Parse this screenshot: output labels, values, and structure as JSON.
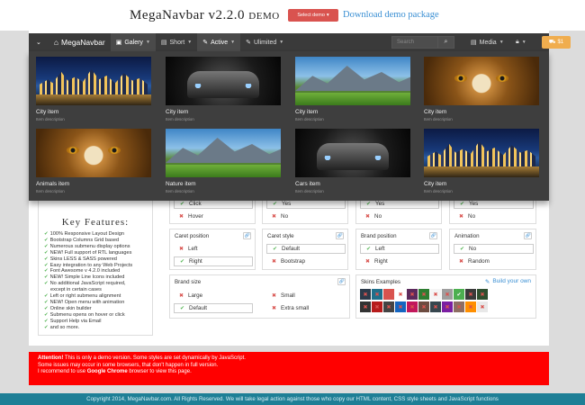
{
  "header": {
    "title_main": "MegaNavbar v2.2.0",
    "title_suffix": "demo",
    "select_demo": "Select demo",
    "download": "Download demo package"
  },
  "navbar": {
    "brand": "MegaNavbar",
    "items": [
      {
        "label": "Galery"
      },
      {
        "label": "Short"
      },
      {
        "label": "Active"
      },
      {
        "label": "Ulimited"
      }
    ],
    "search_placeholder": "Search",
    "media": "Media",
    "cart_count": "$1"
  },
  "dropdown": {
    "tiles": [
      {
        "title": "City item",
        "desc": "Item description",
        "art": "city"
      },
      {
        "title": "City item",
        "desc": "Item description",
        "art": "car"
      },
      {
        "title": "City item",
        "desc": "Item description",
        "art": "mount"
      },
      {
        "title": "City item",
        "desc": "Item description",
        "art": "eagle"
      },
      {
        "title": "Animals item",
        "desc": "Item description",
        "art": "eagle"
      },
      {
        "title": "Nature item",
        "desc": "Item description",
        "art": "mount"
      },
      {
        "title": "Cars item",
        "desc": "Item description",
        "art": "car"
      },
      {
        "title": "City item",
        "desc": "Item description",
        "art": "city"
      }
    ]
  },
  "features": {
    "heading": "Key Features:",
    "items": [
      "100% Responsive Layout Design",
      "Bootstrap Columns Grid based",
      "Numerous submenu display options",
      "NEW! Full support of RTL languages",
      "Skins LESS & SASS powered",
      "Easy integration to any Web Projects",
      "Font Awesome v 4.2.0 included",
      "NEW! Simple Line Icons included",
      "No additional JavaScript required,",
      "except in certain cases",
      "Left or right submenu alignment",
      "NEW! Open menu with animation",
      "Online skin builder",
      "Submenu opens on hover or click",
      "Support Help via Email",
      "and so more."
    ]
  },
  "options": {
    "row1": [
      {
        "a": "Click",
        "b": "Hover"
      },
      {
        "a": "Yes",
        "b": "No"
      },
      {
        "a": "Yes",
        "b": "No"
      },
      {
        "a": "Yes",
        "b": "No"
      }
    ],
    "caret_position": {
      "head": "Caret position",
      "a": "Left",
      "b": "Right"
    },
    "caret_style": {
      "head": "Caret style",
      "a": "Default",
      "b": "Bootstrap"
    },
    "brand_position": {
      "head": "Brand position",
      "a": "Left",
      "b": "Right"
    },
    "animation": {
      "head": "Animation",
      "a": "No",
      "b": "Random"
    },
    "brand_size": {
      "head": "Brand size",
      "large": "Large",
      "small": "Small",
      "default": "Default",
      "xsmall": "Extra small"
    },
    "skins": {
      "head": "Skins Examples",
      "build": "Build your own"
    }
  },
  "skin_colors": [
    "#2b3a4a",
    "#1f6f8b",
    "#d9534f",
    "#ffffff",
    "#5c2a5c",
    "#2e7d32",
    "#f5f5f5",
    "#9e9e9e",
    "#4caf50",
    "#3a3a3a",
    "#2f4f2f",
    "#333333",
    "#b71c1c",
    "#444444",
    "#1565c0",
    "#c2185b",
    "#6d4c41",
    "#37474f",
    "#7b1fa2",
    "#8d6e63",
    "#ff8f00",
    "#e8e8e8"
  ],
  "alert": {
    "label": "Attention!",
    "line1": "This is only a demo version. Some styles are set dynamically by JavaScript.",
    "line2": "Some issues may occur in some browsers, that don't happen in full version.",
    "line3_pre": "I recommend to use",
    "line3_bold": "Google Chrome",
    "line3_post": "browser to view this page."
  },
  "footer": "Copyright 2014, MegaNavbar.com. All Rights Reserved. We will take legal action against those who copy our HTML content, CSS style sheets and JavaScript functions"
}
